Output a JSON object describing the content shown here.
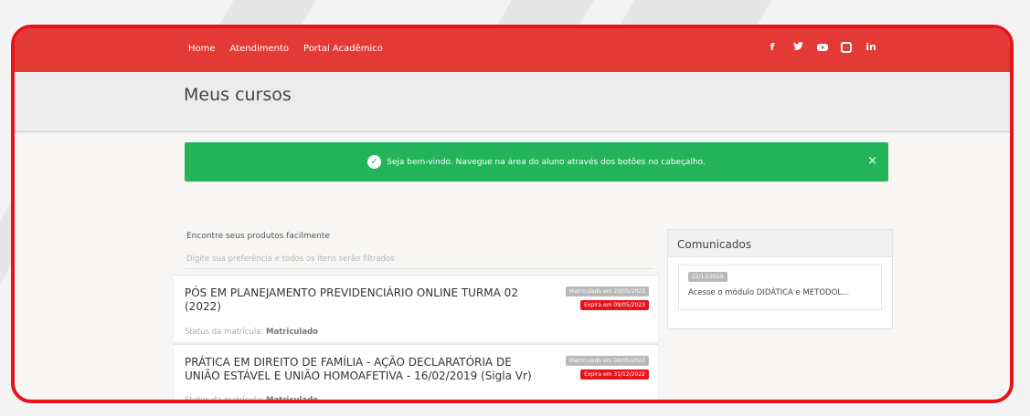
{
  "nav": {
    "links": [
      "Home",
      "Atendimento",
      "Portal Acadêmico"
    ]
  },
  "social": {
    "facebook": "f",
    "twitter": "🐦",
    "linkedin": "in"
  },
  "page": {
    "title": "Meus cursos"
  },
  "alert": {
    "message": "Seja bem-vindo. Navegue na área do aluno através dos botões no cabeçalho.",
    "close": "×"
  },
  "finder": {
    "label": "Encontre seus produtos facilmente",
    "placeholder": "Digite sua preferência e todos os itens serão filtrados"
  },
  "courses": [
    {
      "title": "PÓS EM PLANEJAMENTO PREVIDENCIÁRIO ONLINE TURMA 02 (2022)",
      "enrolled": "Matriculado em 20/05/2022",
      "expires": "Expira em 09/05/2023",
      "status_label": "Status da matrícula:",
      "status_value": "Matriculado"
    },
    {
      "title": "PRÁTICA EM DIREITO DE FAMÍLIA - AÇÃO DECLARATÓRIA DE UNIÃO ESTÁVEL E UNIÃO HOMOAFETIVA - 16/02/2019 (Sigla Vr)",
      "enrolled": "Matriculado em 06/05/2022",
      "expires": "Expira em 31/12/2022",
      "status_label": "Status da matrícula:",
      "status_value": "Matriculado"
    }
  ],
  "comunicados": {
    "title": "Comunicados",
    "items": [
      {
        "date": "22/12/2019",
        "text": "Acesse o módulo DIDÁTICA e METODOL..."
      }
    ]
  },
  "colors": {
    "brand_red": "#e43a36",
    "frame_red": "#e4141b",
    "success_green": "#23b45a"
  }
}
